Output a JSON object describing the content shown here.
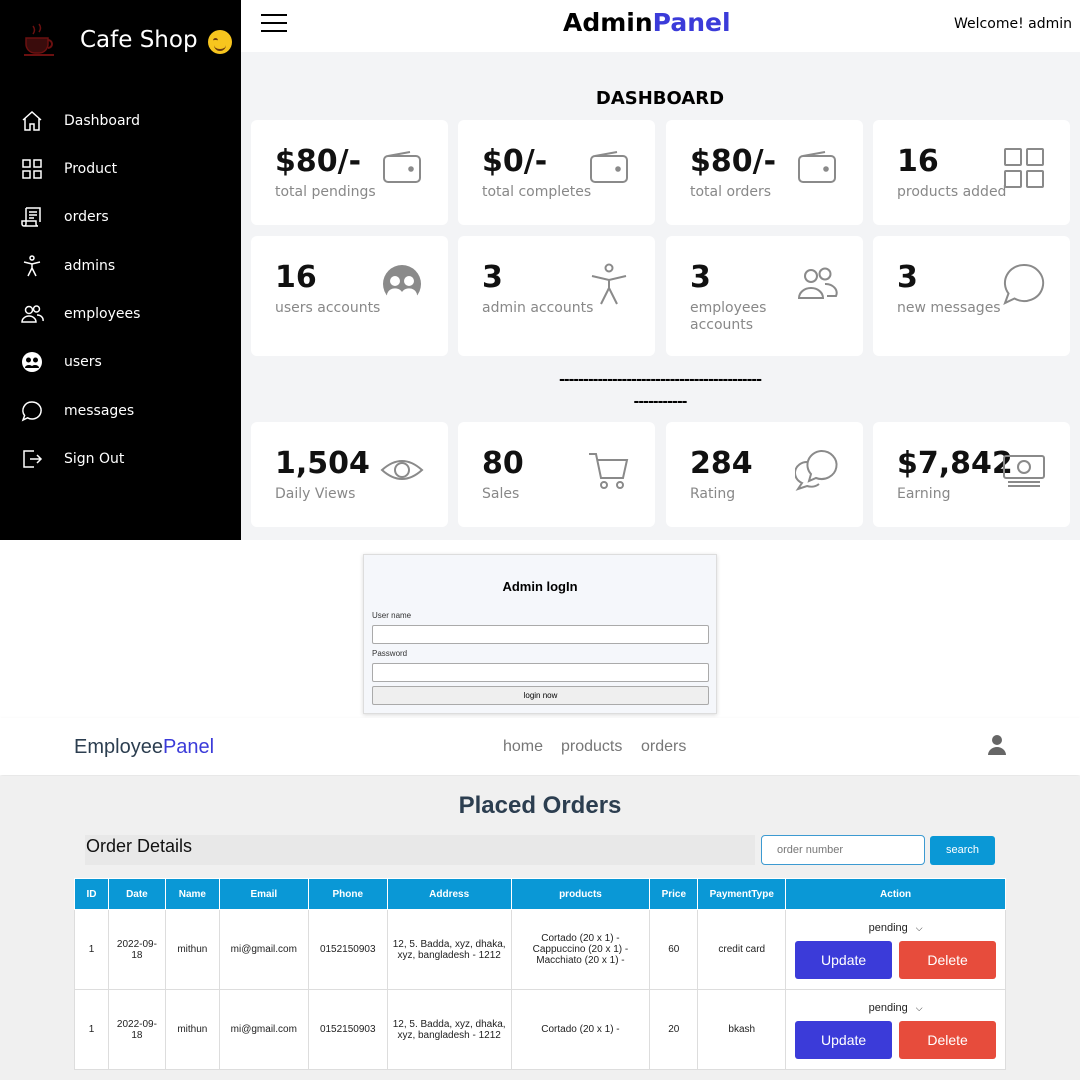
{
  "admin": {
    "brand": "Cafe Shop",
    "title_main": "Admin",
    "title_accent": "Panel",
    "welcome": "Welcome! admin",
    "dashboard_title": "DASHBOARD",
    "divider_line1": "------------------------------------------",
    "divider_line2": "-----------",
    "nav": [
      {
        "label": "Dashboard",
        "icon": "home-icon"
      },
      {
        "label": "Product",
        "icon": "grid-icon"
      },
      {
        "label": "orders",
        "icon": "receipt-icon"
      },
      {
        "label": "admins",
        "icon": "person-icon"
      },
      {
        "label": "employees",
        "icon": "people-icon"
      },
      {
        "label": "users",
        "icon": "user-circle-icon"
      },
      {
        "label": "messages",
        "icon": "chat-icon"
      },
      {
        "label": "Sign Out",
        "icon": "logout-icon"
      }
    ],
    "stats": [
      {
        "value": "$80/-",
        "caption": "total pendings",
        "icon": "wallet-icon"
      },
      {
        "value": "$0/-",
        "caption": "total completes",
        "icon": "wallet-icon"
      },
      {
        "value": "$80/-",
        "caption": "total orders",
        "icon": "wallet-icon"
      },
      {
        "value": "16",
        "caption": "products added",
        "icon": "grid-icon"
      },
      {
        "value": "16",
        "caption": "users accounts",
        "icon": "users-icon"
      },
      {
        "value": "3",
        "caption": "admin accounts",
        "icon": "accessibility-icon"
      },
      {
        "value": "3",
        "caption": "employees accounts",
        "icon": "people-icon"
      },
      {
        "value": "3",
        "caption": "new messages",
        "icon": "chat-icon"
      }
    ],
    "metrics": [
      {
        "value": "1,504",
        "caption": "Daily Views",
        "icon": "eye-icon"
      },
      {
        "value": "80",
        "caption": "Sales",
        "icon": "cart-icon"
      },
      {
        "value": "284",
        "caption": "Rating",
        "icon": "chats-icon"
      },
      {
        "value": "$7,842",
        "caption": "Earning",
        "icon": "money-icon"
      }
    ]
  },
  "login": {
    "title": "Admin logIn",
    "username_label": "User name",
    "password_label": "Password",
    "button": "login now"
  },
  "employee": {
    "logo_main": "Employee",
    "logo_accent": "Panel",
    "nav": [
      "home",
      "products",
      "orders"
    ],
    "page_title": "Placed Orders",
    "details_label": "Order Details",
    "search_placeholder": "order number",
    "search_button": "search",
    "columns": [
      "ID",
      "Date",
      "Name",
      "Email",
      "Phone",
      "Address",
      "products",
      "Price",
      "PaymentType",
      "Action"
    ],
    "rows": [
      {
        "id": "1",
        "date": "2022-09-18",
        "name": "mithun",
        "email": "mi@gmail.com",
        "phone": "0152150903",
        "address": "12, 5. Badda, xyz, dhaka, xyz, bangladesh - 1212",
        "products": "Cortado (20 x 1) - Cappuccino (20 x 1) - Macchiato (20 x 1) -",
        "price": "60",
        "payment": "credit card",
        "status": "pending",
        "update": "Update",
        "delete": "Delete"
      },
      {
        "id": "1",
        "date": "2022-09-18",
        "name": "mithun",
        "email": "mi@gmail.com",
        "phone": "0152150903",
        "address": "12, 5. Badda, xyz, dhaka, xyz, bangladesh - 1212",
        "products": "Cortado (20 x 1) -",
        "price": "20",
        "payment": "bkash",
        "status": "pending",
        "update": "Update",
        "delete": "Delete"
      }
    ]
  },
  "colors": {
    "accent_blue": "#3b3bd9",
    "table_header": "#0a98d6",
    "delete_red": "#e74c3c",
    "sidebar_bg": "#000000"
  }
}
